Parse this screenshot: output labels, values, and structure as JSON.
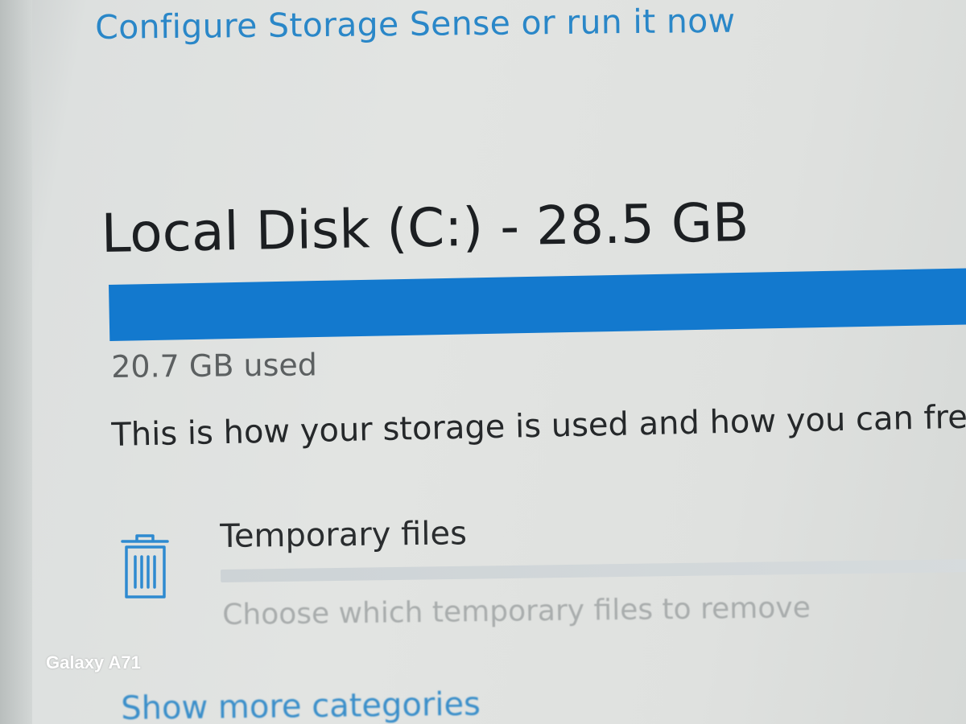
{
  "storage_sense_link": "Configure Storage Sense or run it now",
  "disk": {
    "title": "Local Disk (C:) - 28.5 GB",
    "used_text": "20.7 GB used",
    "usage_fraction": 0.98,
    "bar_color": "#1379ce"
  },
  "description": "This is how your storage is used and how you can free",
  "categories": [
    {
      "icon": "trash-icon",
      "name": "Temporary files",
      "subtitle": "Choose which temporary files to remove"
    }
  ],
  "show_more_link": "Show more categories",
  "watermark": "Galaxy A71"
}
